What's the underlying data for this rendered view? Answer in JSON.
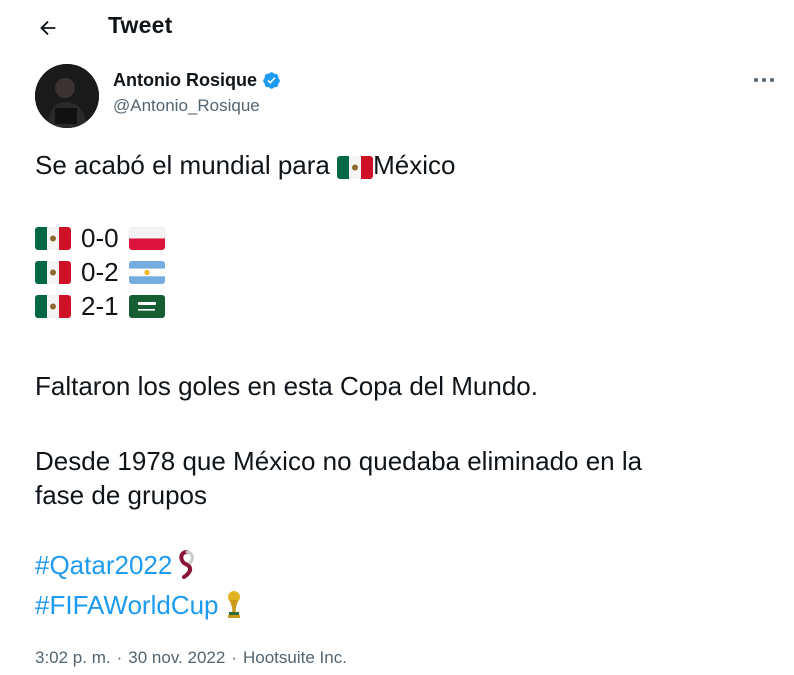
{
  "header": {
    "title": "Tweet",
    "back_icon": "arrow-left-icon"
  },
  "author": {
    "name": "Antonio Rosique",
    "handle": "@Antonio_Rosique",
    "verified_icon": "verified-badge-icon",
    "verified_color": "#1d9bf0"
  },
  "more_icon": "more-options-icon",
  "tweet": {
    "line1_prefix": "Se acabó el mundial para ",
    "line1_country": "México",
    "scores": [
      {
        "team_flag": "mexico-flag-icon",
        "score": "0-0",
        "opponent_flag": "poland-flag-icon"
      },
      {
        "team_flag": "mexico-flag-icon",
        "score": "0-2",
        "opponent_flag": "argentina-flag-icon"
      },
      {
        "team_flag": "mexico-flag-icon",
        "score": "2-1",
        "opponent_flag": "saudi-arabia-flag-icon"
      }
    ],
    "paragraph2": "Faltaron los goles en esta Copa del Mundo.",
    "paragraph3_line1": "Desde 1978 que México no quedaba eliminado en la",
    "paragraph3_line2": "fase de grupos",
    "hashtags": [
      {
        "text": "#Qatar2022",
        "icon": "qatar-2022-hashflag-icon"
      },
      {
        "text": "#FIFAWorldCup",
        "icon": "world-cup-trophy-icon"
      }
    ]
  },
  "meta": {
    "time": "3:02 p. m.",
    "separator1": "·",
    "date": "30 nov. 2022",
    "separator2": "·",
    "source": "Hootsuite Inc."
  },
  "colors": {
    "link": "#1d9bf0",
    "secondary_text": "#536471",
    "primary_text": "#0f1419"
  }
}
